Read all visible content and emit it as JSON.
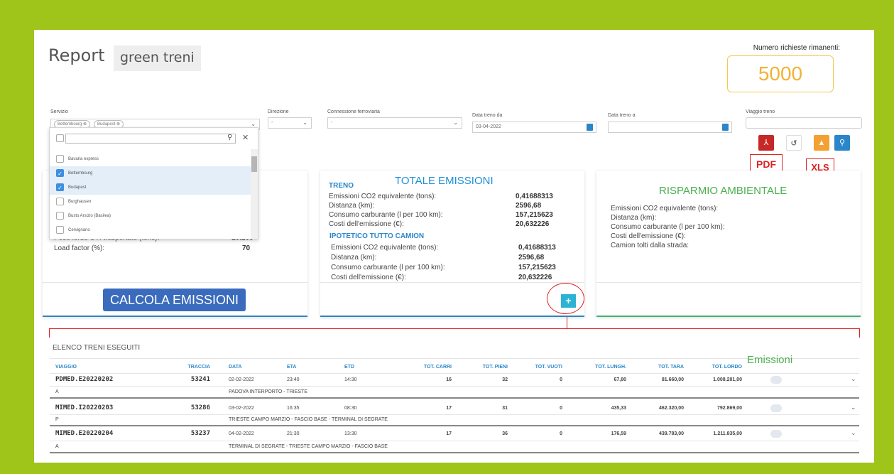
{
  "header": {
    "title_part1": "Report",
    "title_part2": "green treni",
    "requests_label": "Numero richieste rimanenti:",
    "requests_value": "5000"
  },
  "filters": {
    "servizio": {
      "label": "Servizio",
      "chips": [
        "Bettembourg",
        "Budapest"
      ]
    },
    "direzione": {
      "label": "Direzione",
      "value": "-"
    },
    "connessione": {
      "label": "Connessione ferroviaria",
      "value": "-"
    },
    "data_da": {
      "label": "Data treno da",
      "value": "03-04-2022"
    },
    "data_a": {
      "label": "Data treno a",
      "value": ""
    },
    "viaggio": {
      "label": "Viaggio treno",
      "value": ""
    }
  },
  "dropdown": {
    "items": [
      {
        "label": "Bavaria express",
        "checked": false
      },
      {
        "label": "Bettembourg",
        "checked": true
      },
      {
        "label": "Budapest",
        "checked": true
      },
      {
        "label": "Burghausen",
        "checked": false
      },
      {
        "label": "Busto Arsizio (Basilea)",
        "checked": false
      },
      {
        "label": "Cervignano",
        "checked": false
      }
    ]
  },
  "left_card": {
    "rows": [
      {
        "label": "Peso lordo UTI trasportate (tons):",
        "value": "10.200"
      },
      {
        "label": "Load factor (%):",
        "value": "70"
      }
    ],
    "calc_button": "CALCOLA EMISSIONI"
  },
  "mid_card": {
    "title": "TOTALE EMISSIONI",
    "treno_title": "TRENO",
    "treno_rows": [
      {
        "label": "Emissioni CO2 equivalente (tons):",
        "value": "0,41688313"
      },
      {
        "label": "Distanza (km):",
        "value": "2596,68"
      },
      {
        "label": "Consumo carburante (l per 100 km):",
        "value": "157,215623"
      },
      {
        "label": "Costi dell'emissione (€):",
        "value": "20,632226"
      }
    ],
    "camion_title": "IPOTETICO TUTTO CAMION",
    "camion_rows": [
      {
        "label": "Emissioni CO2 equivalente (tons):",
        "value": "0,41688313"
      },
      {
        "label": "Distanza (km):",
        "value": "2596,68"
      },
      {
        "label": "Consumo carburante (l per 100 km):",
        "value": "157,215623"
      },
      {
        "label": "Costi dell'emissione (€):",
        "value": "20,632226"
      }
    ],
    "plus_label": "+"
  },
  "right_card": {
    "title": "RISPARMIO AMBIENTALE",
    "rows": [
      "Emissioni CO2 equivalente (tons):",
      "Distanza (km):",
      "Consumo carburante (l per 100 km):",
      "Costi dell'emissione (€):",
      "Camion tolti dalla strada:"
    ]
  },
  "toolbar": {
    "pdf_label": "PDF",
    "xls_label": "XLS",
    "icons": [
      "pdf-icon",
      "undo-icon",
      "download-icon",
      "search-icon"
    ]
  },
  "list": {
    "title": "ELENCO TRENI ESEGUITI",
    "emissioni_label": "Emissioni",
    "columns": [
      "VIAGGIO",
      "TRACCIA",
      "DATA",
      "ETA",
      "ETD",
      "TOT. CARRI",
      "TOT. PIENI",
      "TOT. VUOTI",
      "TOT. LUNGH.",
      "TOT. TARA",
      "TOT. LORDO"
    ],
    "rows": [
      {
        "viaggio": "PDMED.E20220202",
        "traccia": "53241",
        "data": "02-02-2022",
        "eta": "23:40",
        "etd": "14:30",
        "carri": "16",
        "pieni": "32",
        "vuoti": "0",
        "lungh": "67,80",
        "tara": "81.660,00",
        "lordo": "1.008.201,00",
        "dir": "A",
        "route": "PADOVA INTERPORTO - TRIESTE"
      },
      {
        "viaggio": "MIMED.I20220203",
        "traccia": "53286",
        "data": "03-02-2022",
        "eta": "16:35",
        "etd": "08:30",
        "carri": "17",
        "pieni": "31",
        "vuoti": "0",
        "lungh": "435,33",
        "tara": "462.320,00",
        "lordo": "792.869,00",
        "dir": "P",
        "route": "TRIESTE CAMPO MARZIO - FASCIO BASE - TERMINAL DI SEGRATE"
      },
      {
        "viaggio": "MIMED.E20220204",
        "traccia": "53237",
        "data": "04-02-2022",
        "eta": "21:30",
        "etd": "13:30",
        "carri": "17",
        "pieni": "36",
        "vuoti": "0",
        "lungh": "176,59",
        "tara": "439.783,00",
        "lordo": "1.211.835,00",
        "dir": "A",
        "route": "TERMINAL DI SEGRATE - TRIESTE CAMPO MARZIO - FASCIO BASE"
      }
    ]
  }
}
